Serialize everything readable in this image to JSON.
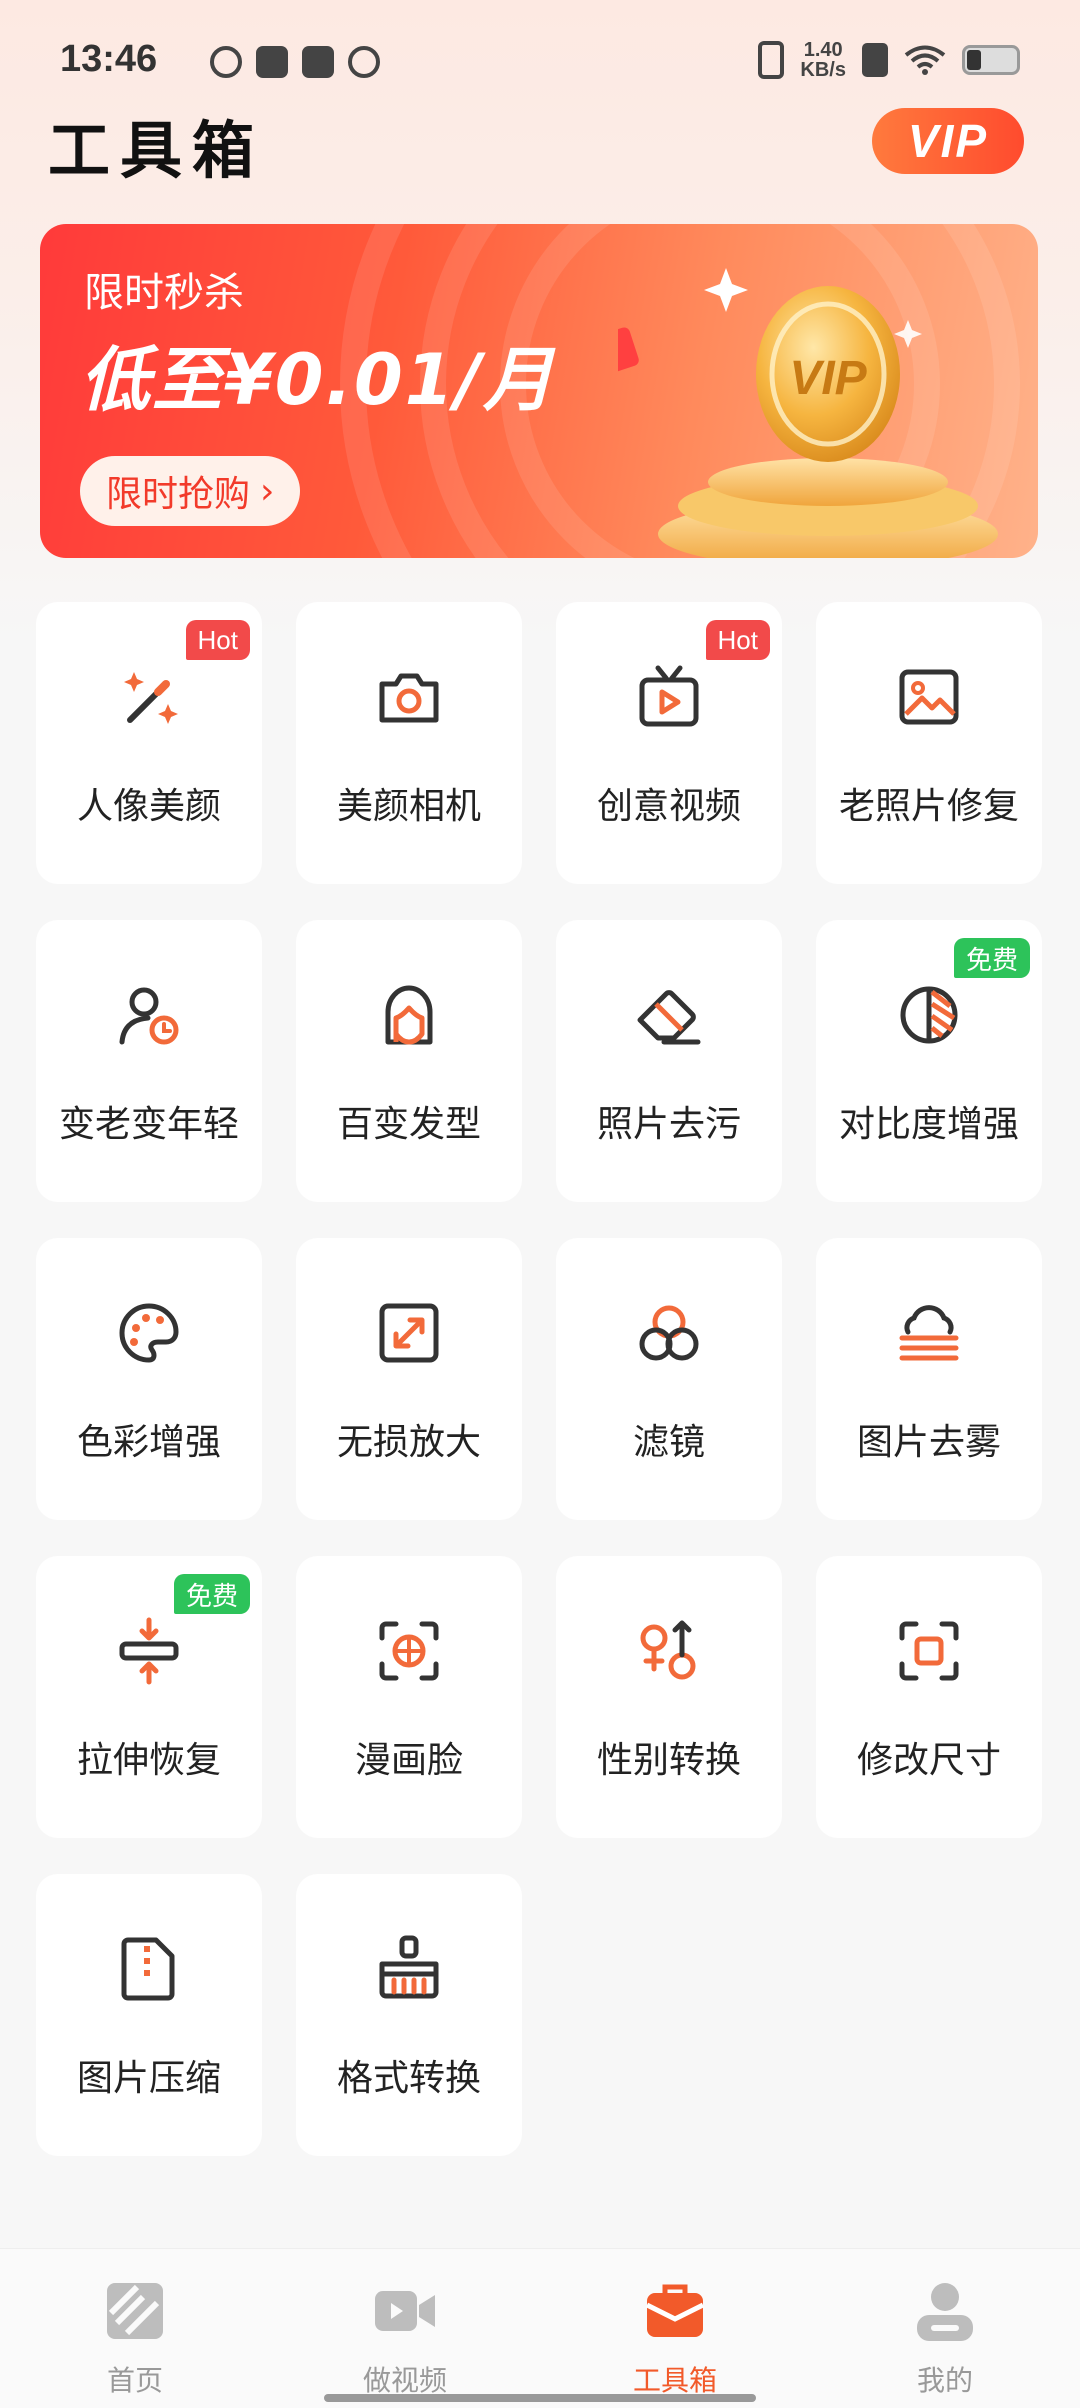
{
  "status_bar": {
    "time": "13:46",
    "net_speed_value": "1.40",
    "net_speed_unit": "KB/s"
  },
  "header": {
    "title": "工具箱",
    "vip_label": "VIP"
  },
  "banner": {
    "kicker": "限时秒杀",
    "headline": "低至¥0.01/月",
    "cta_label": "限时抢购",
    "cta_arrow": "›",
    "coin_label": "VIP"
  },
  "tools": [
    {
      "label": "人像美颜",
      "tag": "Hot",
      "icon": "magic-wand-icon"
    },
    {
      "label": "美颜相机",
      "tag": "",
      "icon": "camera-icon"
    },
    {
      "label": "创意视频",
      "tag": "Hot",
      "icon": "tv-play-icon"
    },
    {
      "label": "老照片修复",
      "tag": "",
      "icon": "image-icon"
    },
    {
      "label": "变老变年轻",
      "tag": "",
      "icon": "person-clock-icon"
    },
    {
      "label": "百变发型",
      "tag": "",
      "icon": "hairstyle-icon"
    },
    {
      "label": "照片去污",
      "tag": "",
      "icon": "eraser-icon"
    },
    {
      "label": "对比度增强",
      "tag": "免费",
      "icon": "contrast-icon"
    },
    {
      "label": "色彩增强",
      "tag": "",
      "icon": "palette-icon"
    },
    {
      "label": "无损放大",
      "tag": "",
      "icon": "expand-icon"
    },
    {
      "label": "滤镜",
      "tag": "",
      "icon": "filter-circles-icon"
    },
    {
      "label": "图片去雾",
      "tag": "",
      "icon": "defog-icon"
    },
    {
      "label": "拉伸恢复",
      "tag": "免费",
      "icon": "compress-vertical-icon"
    },
    {
      "label": "漫画脸",
      "tag": "",
      "icon": "face-scan-icon"
    },
    {
      "label": "性别转换",
      "tag": "",
      "icon": "gender-icon"
    },
    {
      "label": "修改尺寸",
      "tag": "",
      "icon": "resize-icon"
    },
    {
      "label": "图片压缩",
      "tag": "",
      "icon": "zip-file-icon"
    },
    {
      "label": "格式转换",
      "tag": "",
      "icon": "brush-icon"
    }
  ],
  "bottom_nav": [
    {
      "label": "首页",
      "icon": "home-icon",
      "active": false
    },
    {
      "label": "做视频",
      "icon": "video-camera-icon",
      "active": false
    },
    {
      "label": "工具箱",
      "icon": "toolbox-icon",
      "active": true
    },
    {
      "label": "我的",
      "icon": "profile-icon",
      "active": false
    }
  ],
  "colors": {
    "accent": "#f25a2a",
    "hot_tag": "#f24a4a",
    "free_tag": "#2dc35a",
    "icon_dark": "#333333",
    "icon_accent": "#f26a3a"
  }
}
